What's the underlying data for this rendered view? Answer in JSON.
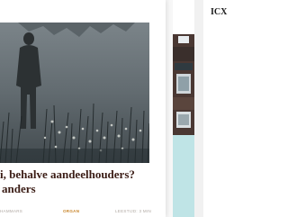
{
  "main_article": {
    "title_line1": "i, behalve aandeelhouders?",
    "title_line2": "anders",
    "meta": {
      "author": "HAMMARS",
      "category": "ORGAN",
      "read_time": "LEESTIJD: 3 MIN"
    }
  },
  "right_article": {
    "heading_fragment": "ICX"
  },
  "colors": {
    "title_text": "#3b1d16",
    "category_accent": "#c8842a",
    "teal_panel": "#bfe4e6"
  }
}
